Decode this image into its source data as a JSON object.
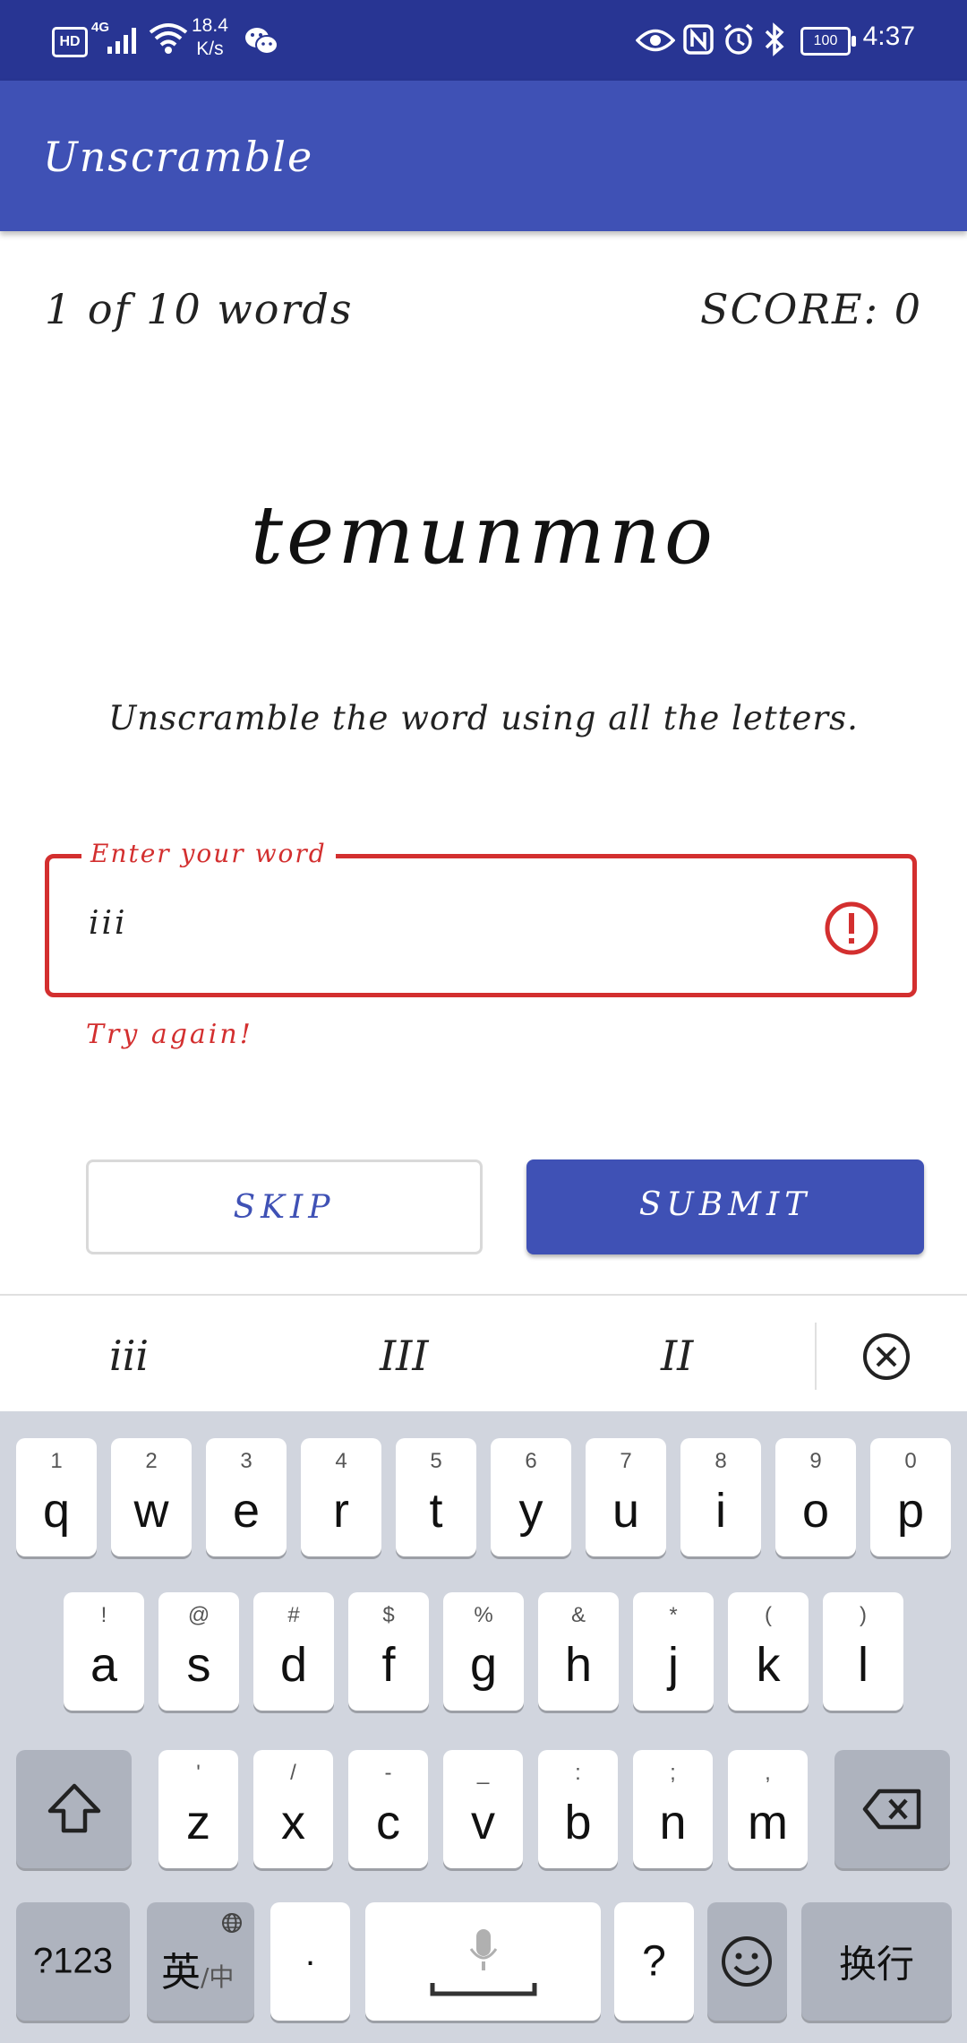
{
  "status_bar": {
    "hd": "HD",
    "network": "4G",
    "speed_value": "18.4",
    "speed_unit": "K/s",
    "battery": "100",
    "time": "4:37"
  },
  "app_bar": {
    "title": "Unscramble"
  },
  "game": {
    "word_count": "1 of 10 words",
    "score": "SCORE: 0",
    "scrambled_word": "temunmno",
    "instructions": "Unscramble the word using all the letters."
  },
  "input": {
    "label": "Enter your word",
    "value": "iii",
    "error": "Try again!",
    "error_color": "#d32f2f"
  },
  "buttons": {
    "skip": "SKIP",
    "submit": "SUBMIT"
  },
  "keyboard": {
    "suggestions": [
      "iii",
      "III",
      "II"
    ],
    "row1": [
      {
        "k": "q",
        "s": "1"
      },
      {
        "k": "w",
        "s": "2"
      },
      {
        "k": "e",
        "s": "3"
      },
      {
        "k": "r",
        "s": "4"
      },
      {
        "k": "t",
        "s": "5"
      },
      {
        "k": "y",
        "s": "6"
      },
      {
        "k": "u",
        "s": "7"
      },
      {
        "k": "i",
        "s": "8"
      },
      {
        "k": "o",
        "s": "9"
      },
      {
        "k": "p",
        "s": "0"
      }
    ],
    "row2": [
      {
        "k": "a",
        "s": "!"
      },
      {
        "k": "s",
        "s": "@"
      },
      {
        "k": "d",
        "s": "#"
      },
      {
        "k": "f",
        "s": "$"
      },
      {
        "k": "g",
        "s": "%"
      },
      {
        "k": "h",
        "s": "&"
      },
      {
        "k": "j",
        "s": "*"
      },
      {
        "k": "k",
        "s": "("
      },
      {
        "k": "l",
        "s": ")"
      }
    ],
    "row3": [
      {
        "k": "z",
        "s": "'"
      },
      {
        "k": "x",
        "s": "/"
      },
      {
        "k": "c",
        "s": "-"
      },
      {
        "k": "v",
        "s": "_"
      },
      {
        "k": "b",
        "s": ":"
      },
      {
        "k": "n",
        "s": ";"
      },
      {
        "k": "m",
        "s": ","
      }
    ],
    "symbols_key": "?123",
    "lang_main": "英",
    "lang_sub": "/中",
    "dot_key": "·",
    "question_key": "?",
    "enter_key": "换行"
  },
  "colors": {
    "status_bar": "#283593",
    "primary": "#3f51b5",
    "error": "#d32f2f"
  }
}
